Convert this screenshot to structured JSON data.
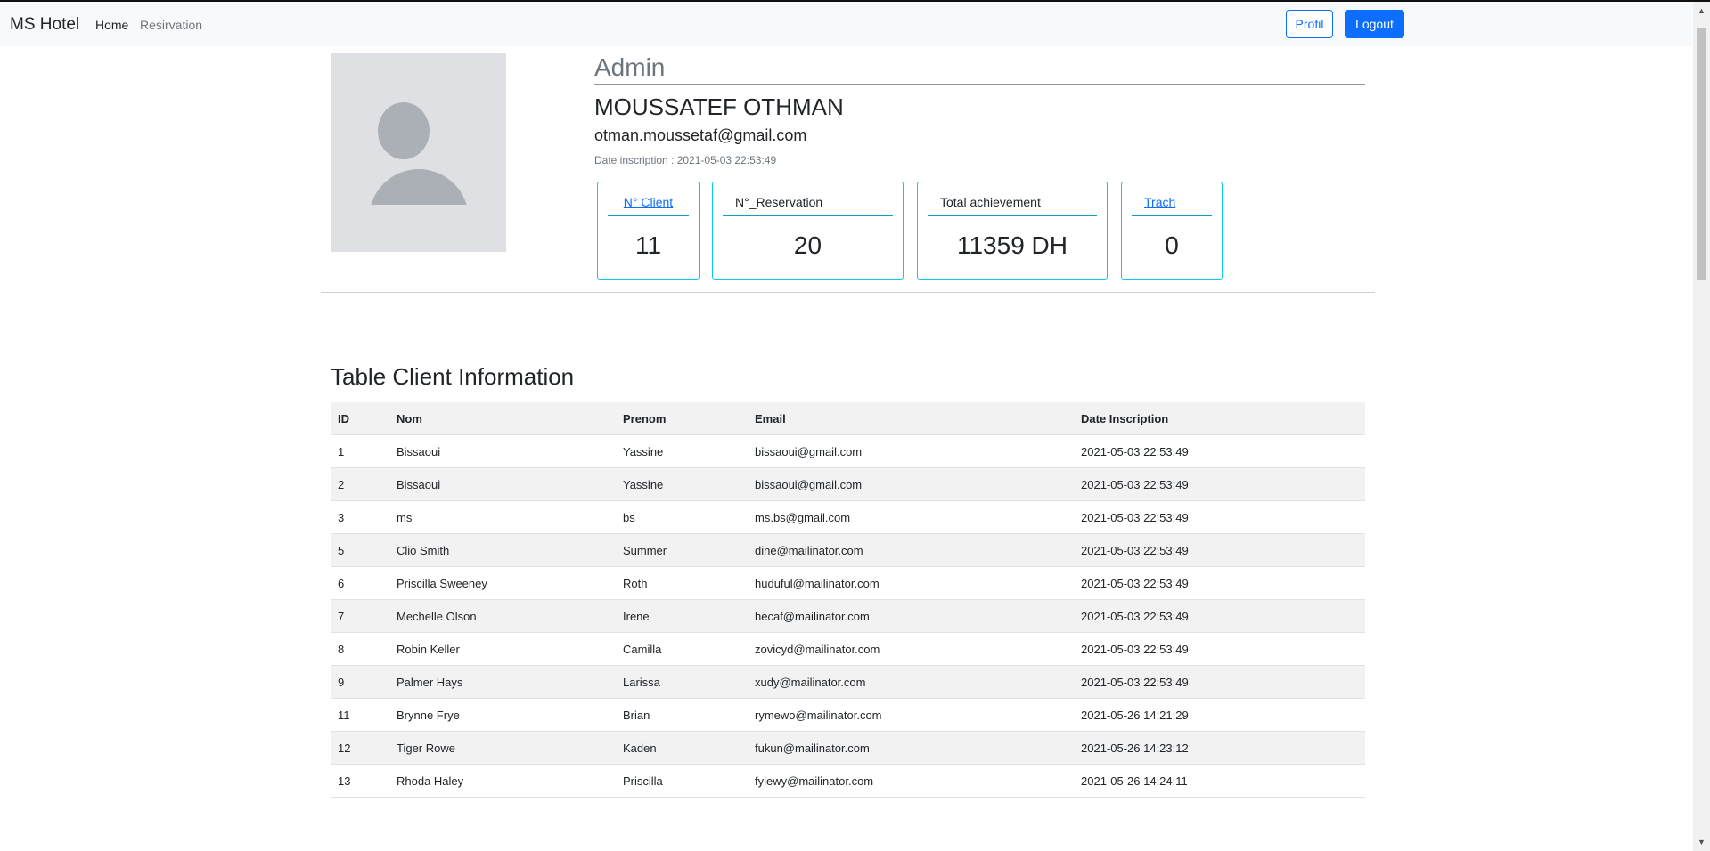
{
  "navbar": {
    "brand": "MS Hotel",
    "home": "Home",
    "reservation": "Resirvation",
    "profil_button": "Profil",
    "logout_button": "Logout"
  },
  "profile": {
    "role": "Admin",
    "name": "MOUSSATEF OTHMAN",
    "email": "otman.moussetaf@gmail.com",
    "date_inscription": "Date inscription : 2021-05-03 22:53:49"
  },
  "stats": [
    {
      "label": "N° Client",
      "value": "11"
    },
    {
      "label": "N°_Reservation",
      "value": "20"
    },
    {
      "label": "Total achievement",
      "value": "11359 DH"
    },
    {
      "label": "Trach",
      "value": "0"
    }
  ],
  "table": {
    "title": "Table Client Information",
    "headers": [
      "ID",
      "Nom",
      "Prenom",
      "Email",
      "Date Inscription"
    ],
    "rows": [
      [
        "1",
        "Bissaoui",
        "Yassine",
        "bissaoui@gmail.com",
        "2021-05-03 22:53:49"
      ],
      [
        "2",
        "Bissaoui",
        "Yassine",
        "bissaoui@gmail.com",
        "2021-05-03 22:53:49"
      ],
      [
        "3",
        "ms",
        "bs",
        "ms.bs@gmail.com",
        "2021-05-03 22:53:49"
      ],
      [
        "5",
        "Clio Smith",
        "Summer",
        "dine@mailinator.com",
        "2021-05-03 22:53:49"
      ],
      [
        "6",
        "Priscilla Sweeney",
        "Roth",
        "huduful@mailinator.com",
        "2021-05-03 22:53:49"
      ],
      [
        "7",
        "Mechelle Olson",
        "Irene",
        "hecaf@mailinator.com",
        "2021-05-03 22:53:49"
      ],
      [
        "8",
        "Robin Keller",
        "Camilla",
        "zovicyd@mailinator.com",
        "2021-05-03 22:53:49"
      ],
      [
        "9",
        "Palmer Hays",
        "Larissa",
        "xudy@mailinator.com",
        "2021-05-03 22:53:49"
      ],
      [
        "11",
        "Brynne Frye",
        "Brian",
        "rymewo@mailinator.com",
        "2021-05-26 14:21:29"
      ],
      [
        "12",
        "Tiger Rowe",
        "Kaden",
        "fukun@mailinator.com",
        "2021-05-26 14:23:12"
      ],
      [
        "13",
        "Rhoda Haley",
        "Priscilla",
        "fylewy@mailinator.com",
        "2021-05-26 14:24:11"
      ]
    ]
  },
  "colors": {
    "primary": "#0d6efd",
    "card_border": "#0dcaf0",
    "navbar_bg": "#f8f9fa",
    "stripe": "#f2f2f2"
  }
}
